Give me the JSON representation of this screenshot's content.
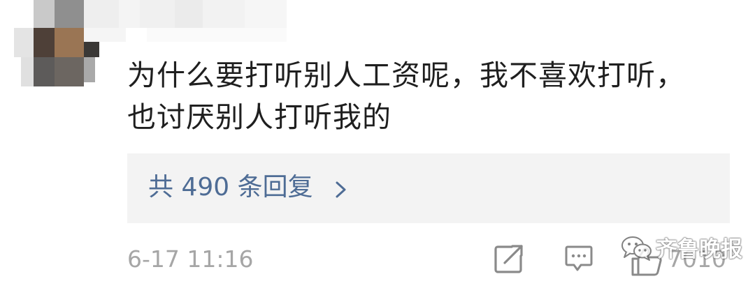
{
  "comment": {
    "lines": [
      "为什么要打听别人工资呢，我不喜欢打听，",
      "也讨厌别人打听我的"
    ]
  },
  "replies": {
    "label": "共 490 条回复"
  },
  "footer": {
    "timestamp": "6-17 11:16",
    "like_count": "7010"
  },
  "watermark": {
    "text": "齐鲁晚报"
  },
  "icons": {
    "avatar": "avatar-pixelated",
    "share": "share-icon",
    "comment": "comment-icon",
    "like": "thumbs-up-icon",
    "watermark": "wechat-logo-icon"
  },
  "colors": {
    "comment_text": "#1f1f1f",
    "reply_link": "#4e6c95",
    "muted": "#a6a6a6",
    "reply_background": "#f3f3f3"
  }
}
